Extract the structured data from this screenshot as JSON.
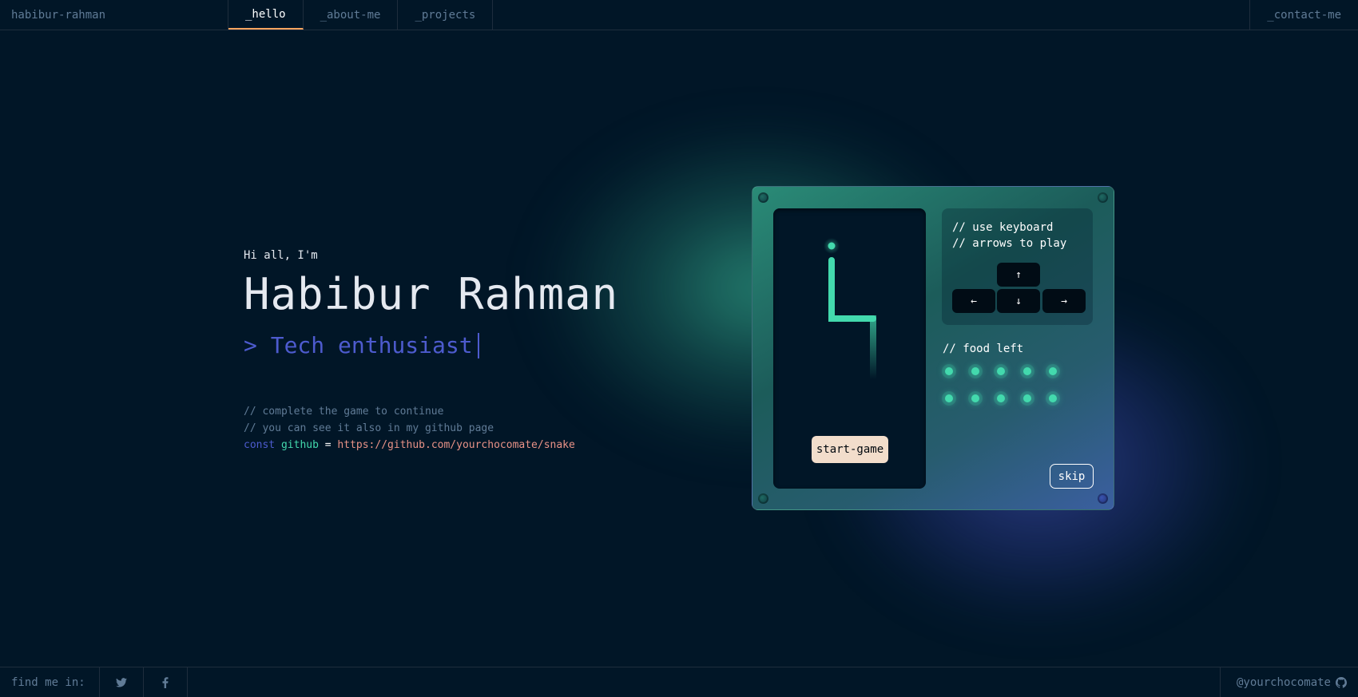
{
  "header": {
    "brand": "habibur-rahman",
    "tabs": [
      {
        "label": "_hello",
        "active": true
      },
      {
        "label": "_about-me",
        "active": false
      },
      {
        "label": "_projects",
        "active": false
      }
    ],
    "contact": "_contact-me"
  },
  "hero": {
    "greeting": "Hi all, I'm",
    "name": "Habibur Rahman",
    "role": "> Tech enthusiast",
    "comment1": "// complete the game to continue",
    "comment2": "// you can see it also in my github page",
    "code_keyword": "const",
    "code_var": "github",
    "code_eq": "=",
    "code_url": "https://github.com/yourchocomate/snake"
  },
  "game": {
    "start_label": "start-game",
    "instructions_line1": "// use keyboard",
    "instructions_line2": "// arrows to play",
    "keys": {
      "up": "↑",
      "left": "←",
      "down": "↓",
      "right": "→"
    },
    "food_label": "// food left",
    "food_count": 10,
    "skip_label": "skip"
  },
  "footer": {
    "find_label": "find me in:",
    "social": [
      "twitter-icon",
      "facebook-icon"
    ],
    "handle": "@yourchocomate",
    "handle_icon": "github-icon"
  },
  "colors": {
    "background": "#011627",
    "accent_orange": "#FEA55F",
    "accent_green": "#43D9AD",
    "accent_blue": "#4D5BCE",
    "string_pink": "#E99287",
    "muted": "#607B96"
  }
}
